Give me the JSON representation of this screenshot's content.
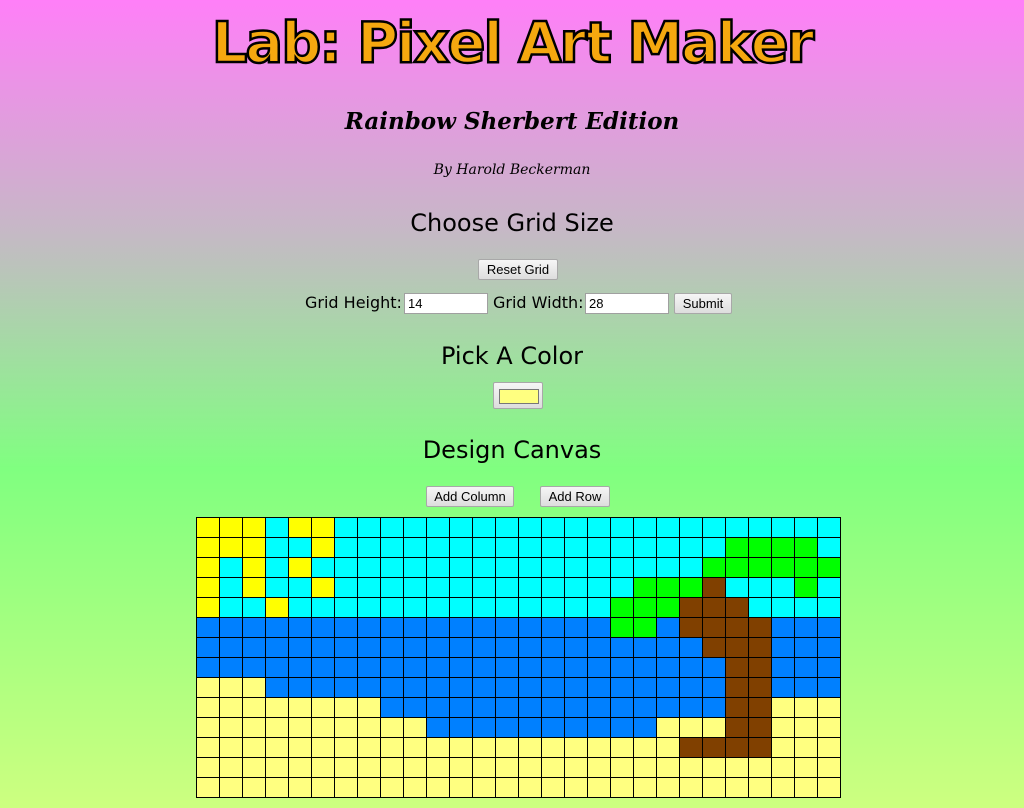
{
  "header": {
    "title": "Lab: Pixel Art Maker",
    "subtitle": "Rainbow Sherbert Edition",
    "byline": "By Harold Beckerman"
  },
  "grid_size": {
    "heading": "Choose Grid Size",
    "reset_label": "Reset Grid",
    "height_label": "Grid Height:",
    "height_value": "14",
    "width_label": "Grid Width:",
    "width_value": "28",
    "submit_label": "Submit"
  },
  "color": {
    "heading": "Pick A Color",
    "selected_color": "#ffff80"
  },
  "design": {
    "heading": "Design Canvas",
    "add_column_label": "Add Column",
    "add_row_label": "Add Row"
  },
  "canvas": {
    "palette": {
      "Y": "#ffff00",
      "C": "#00ffff",
      "B": "#0080ff",
      "S": "#ffff80",
      "G": "#00ff00",
      "T": "#804000"
    },
    "rows": [
      "YYYCYYCCCCCCCCCCCCCCCCCCCCCC",
      "YYYCCYCCCCCCCCCCCCCCCCCGGGGC",
      "YCYCYCCCCCCCCCCCCCCCCCGGGGGG",
      "YCYCCYCCCCCCCCCCCCCGGGTCCCGC",
      "YCCYCCCCCCCCCCCCCCGGGTTTCCCC",
      "BBBBBBBBBBBBBBBBBBGGBTTTTBBB",
      "BBBBBBBBBBBBBBBBBBBBBBTTTBBB",
      "BBBBBBBBBBBBBBBBBBBBBBBTTBBB",
      "SSSBBBBBBBBBBBBBBBBBBBBTTBBB",
      "SSSSSSSSBBBBBBBBBBBBBBBTTSSS",
      "SSSSSSSSSSBBBBBBBBBBSSSTTSSS",
      "SSSSSSSSSSSSSSSSSSSSSTTTTSSS",
      "SSSSSSSSSSSSSSSSSSSSSSSSSSSS",
      "SSSSSSSSSSSSSSSSSSSSSSSSSSSS"
    ]
  }
}
